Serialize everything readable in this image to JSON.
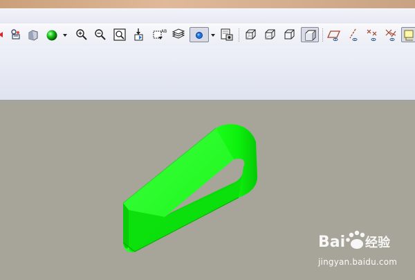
{
  "toolbar": {
    "buttons": [
      {
        "icon": "regenerate-icon"
      },
      {
        "icon": "orient-icon"
      },
      {
        "icon": "appearance-sphere-icon"
      },
      {
        "icon": "dropdown-arrow-icon"
      },
      {
        "icon": "zoom-in-icon"
      },
      {
        "icon": "zoom-out-icon"
      },
      {
        "icon": "refit-icon"
      },
      {
        "icon": "repaint-icon"
      },
      {
        "icon": "spin-center-icon"
      },
      {
        "icon": "layers-icon"
      },
      {
        "icon": "display-style-icon"
      },
      {
        "icon": "view-manager-icon"
      },
      {
        "icon": "wireframe-icon"
      },
      {
        "icon": "hidden-line-icon"
      },
      {
        "icon": "no-hidden-icon"
      },
      {
        "icon": "shading-icon"
      },
      {
        "icon": "datum-plane-icon"
      },
      {
        "icon": "datum-axis-icon"
      },
      {
        "icon": "datum-point-icon"
      },
      {
        "icon": "coordinate-system-icon"
      },
      {
        "icon": "annotation-icon"
      }
    ],
    "active_style": "shading",
    "accent": "#1c74e6"
  },
  "model": {
    "shape": "sheet-metal-loop",
    "color": "#00ff00"
  },
  "watermark": {
    "brand_text": "Bai 经验",
    "url": "jingyan.baidu.com"
  }
}
